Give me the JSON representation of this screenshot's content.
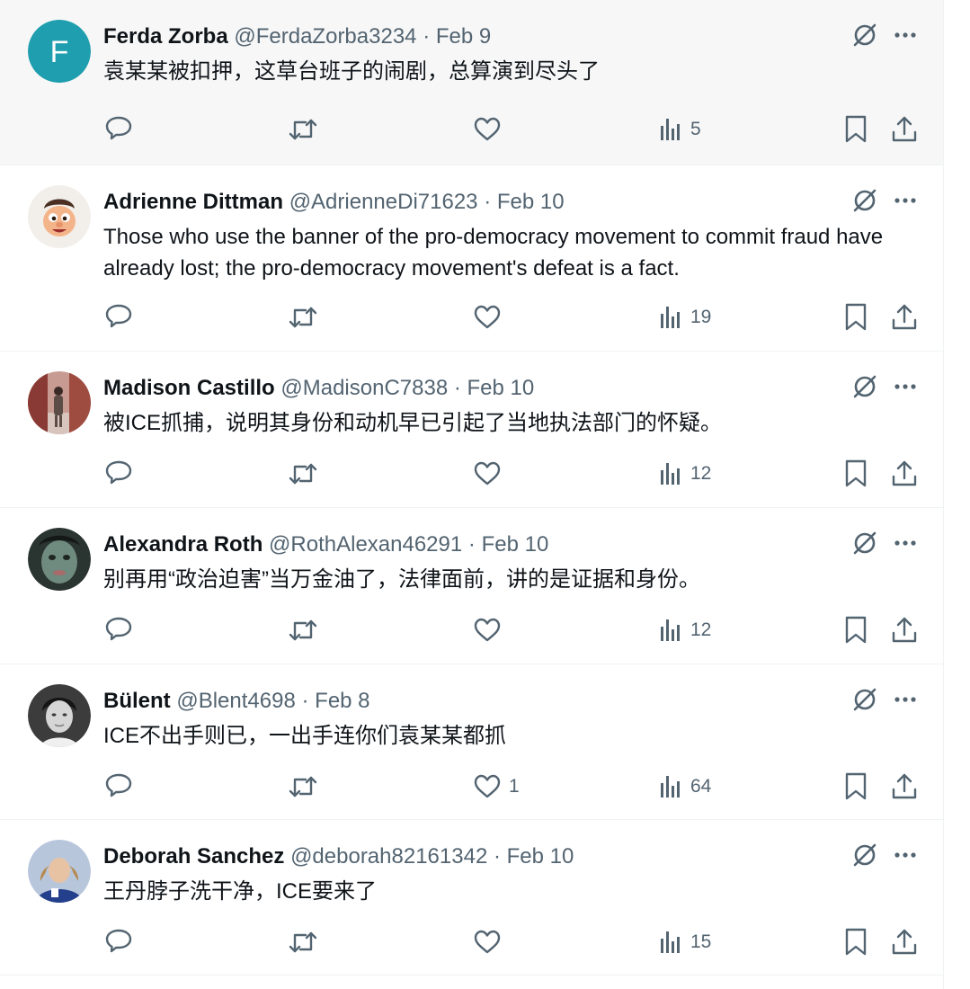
{
  "tweets": [
    {
      "name": "Ferda Zorba",
      "handle": "@FerdaZorba3234",
      "separator": "·",
      "date": "Feb 9",
      "text": "袁某某被扣押，这草台班子的闹剧，总算演到尽头了",
      "avatar_letter": "F",
      "avatar_color": "#1e9eae",
      "likes": "",
      "views": "5"
    },
    {
      "name": "Adrienne Dittman",
      "handle": "@AdrienneDi71623",
      "separator": "·",
      "date": "Feb 10",
      "text": "Those who use the banner of the pro-democracy movement to commit fraud have already lost; the pro-democracy movement's defeat is a fact.",
      "avatar_letter": "",
      "avatar_color": "#f2e4d8",
      "likes": "",
      "views": "19"
    },
    {
      "name": "Madison Castillo",
      "handle": "@MadisonC7838",
      "separator": "·",
      "date": "Feb 10",
      "text": "被ICE抓捕，说明其身份和动机早已引起了当地执法部门的怀疑。",
      "avatar_letter": "",
      "avatar_color": "#b77b70",
      "likes": "",
      "views": "12"
    },
    {
      "name": "Alexandra Roth",
      "handle": "@RothAlexan46291",
      "separator": "·",
      "date": "Feb 10",
      "text": "别再用“政治迫害”当万金油了，法律面前，讲的是证据和身份。",
      "avatar_letter": "",
      "avatar_color": "#3a4a44",
      "likes": "",
      "views": "12"
    },
    {
      "name": "Bülent",
      "handle": "@Blent4698",
      "separator": "·",
      "date": "Feb 8",
      "text": "ICE不出手则已，一出手连你们袁某某都抓",
      "avatar_letter": "",
      "avatar_color": "#2b2b2b",
      "likes": "1",
      "views": "64"
    },
    {
      "name": "Deborah Sanchez",
      "handle": "@deborah82161342",
      "separator": "·",
      "date": "Feb 10",
      "text": "王丹脖子洗干净，ICE要来了",
      "avatar_letter": "",
      "avatar_color": "#2b4f9e",
      "likes": "",
      "views": "15"
    }
  ],
  "icons": {
    "grok": "grok-icon",
    "more": "more-icon",
    "reply": "reply-icon",
    "repost": "repost-icon",
    "like": "like-icon",
    "views": "views-icon",
    "bookmark": "bookmark-icon",
    "share": "share-icon"
  },
  "colors": {
    "text_primary": "#0f1419",
    "text_secondary": "#536471",
    "divider": "#eff3f4",
    "hover_bg": "#f7f7f7"
  }
}
